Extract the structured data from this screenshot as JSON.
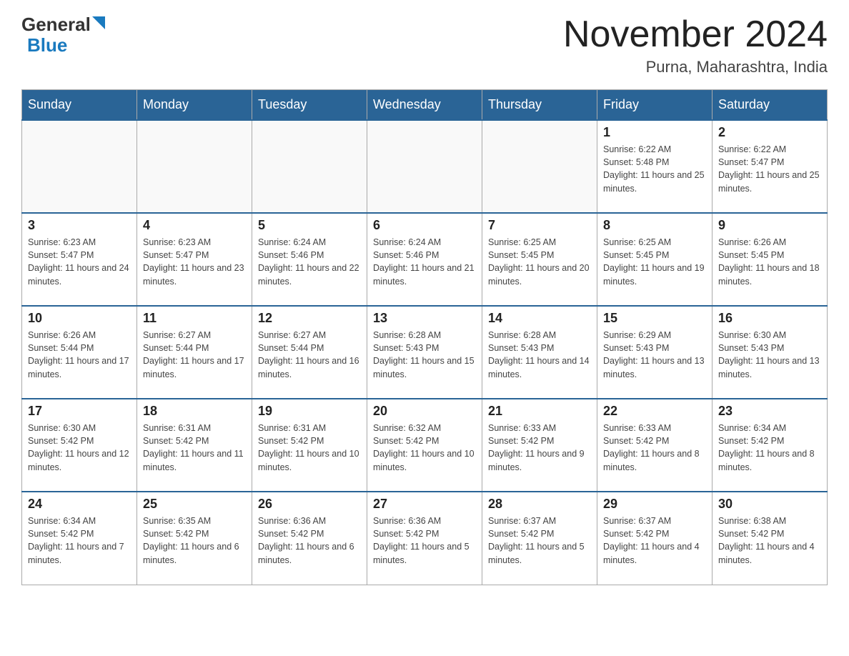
{
  "header": {
    "logo": {
      "general_text": "General",
      "blue_text": "Blue"
    },
    "title": "November 2024",
    "location": "Purna, Maharashtra, India"
  },
  "calendar": {
    "weekdays": [
      "Sunday",
      "Monday",
      "Tuesday",
      "Wednesday",
      "Thursday",
      "Friday",
      "Saturday"
    ],
    "weeks": [
      [
        {
          "day": "",
          "info": ""
        },
        {
          "day": "",
          "info": ""
        },
        {
          "day": "",
          "info": ""
        },
        {
          "day": "",
          "info": ""
        },
        {
          "day": "",
          "info": ""
        },
        {
          "day": "1",
          "info": "Sunrise: 6:22 AM\nSunset: 5:48 PM\nDaylight: 11 hours and 25 minutes."
        },
        {
          "day": "2",
          "info": "Sunrise: 6:22 AM\nSunset: 5:47 PM\nDaylight: 11 hours and 25 minutes."
        }
      ],
      [
        {
          "day": "3",
          "info": "Sunrise: 6:23 AM\nSunset: 5:47 PM\nDaylight: 11 hours and 24 minutes."
        },
        {
          "day": "4",
          "info": "Sunrise: 6:23 AM\nSunset: 5:47 PM\nDaylight: 11 hours and 23 minutes."
        },
        {
          "day": "5",
          "info": "Sunrise: 6:24 AM\nSunset: 5:46 PM\nDaylight: 11 hours and 22 minutes."
        },
        {
          "day": "6",
          "info": "Sunrise: 6:24 AM\nSunset: 5:46 PM\nDaylight: 11 hours and 21 minutes."
        },
        {
          "day": "7",
          "info": "Sunrise: 6:25 AM\nSunset: 5:45 PM\nDaylight: 11 hours and 20 minutes."
        },
        {
          "day": "8",
          "info": "Sunrise: 6:25 AM\nSunset: 5:45 PM\nDaylight: 11 hours and 19 minutes."
        },
        {
          "day": "9",
          "info": "Sunrise: 6:26 AM\nSunset: 5:45 PM\nDaylight: 11 hours and 18 minutes."
        }
      ],
      [
        {
          "day": "10",
          "info": "Sunrise: 6:26 AM\nSunset: 5:44 PM\nDaylight: 11 hours and 17 minutes."
        },
        {
          "day": "11",
          "info": "Sunrise: 6:27 AM\nSunset: 5:44 PM\nDaylight: 11 hours and 17 minutes."
        },
        {
          "day": "12",
          "info": "Sunrise: 6:27 AM\nSunset: 5:44 PM\nDaylight: 11 hours and 16 minutes."
        },
        {
          "day": "13",
          "info": "Sunrise: 6:28 AM\nSunset: 5:43 PM\nDaylight: 11 hours and 15 minutes."
        },
        {
          "day": "14",
          "info": "Sunrise: 6:28 AM\nSunset: 5:43 PM\nDaylight: 11 hours and 14 minutes."
        },
        {
          "day": "15",
          "info": "Sunrise: 6:29 AM\nSunset: 5:43 PM\nDaylight: 11 hours and 13 minutes."
        },
        {
          "day": "16",
          "info": "Sunrise: 6:30 AM\nSunset: 5:43 PM\nDaylight: 11 hours and 13 minutes."
        }
      ],
      [
        {
          "day": "17",
          "info": "Sunrise: 6:30 AM\nSunset: 5:42 PM\nDaylight: 11 hours and 12 minutes."
        },
        {
          "day": "18",
          "info": "Sunrise: 6:31 AM\nSunset: 5:42 PM\nDaylight: 11 hours and 11 minutes."
        },
        {
          "day": "19",
          "info": "Sunrise: 6:31 AM\nSunset: 5:42 PM\nDaylight: 11 hours and 10 minutes."
        },
        {
          "day": "20",
          "info": "Sunrise: 6:32 AM\nSunset: 5:42 PM\nDaylight: 11 hours and 10 minutes."
        },
        {
          "day": "21",
          "info": "Sunrise: 6:33 AM\nSunset: 5:42 PM\nDaylight: 11 hours and 9 minutes."
        },
        {
          "day": "22",
          "info": "Sunrise: 6:33 AM\nSunset: 5:42 PM\nDaylight: 11 hours and 8 minutes."
        },
        {
          "day": "23",
          "info": "Sunrise: 6:34 AM\nSunset: 5:42 PM\nDaylight: 11 hours and 8 minutes."
        }
      ],
      [
        {
          "day": "24",
          "info": "Sunrise: 6:34 AM\nSunset: 5:42 PM\nDaylight: 11 hours and 7 minutes."
        },
        {
          "day": "25",
          "info": "Sunrise: 6:35 AM\nSunset: 5:42 PM\nDaylight: 11 hours and 6 minutes."
        },
        {
          "day": "26",
          "info": "Sunrise: 6:36 AM\nSunset: 5:42 PM\nDaylight: 11 hours and 6 minutes."
        },
        {
          "day": "27",
          "info": "Sunrise: 6:36 AM\nSunset: 5:42 PM\nDaylight: 11 hours and 5 minutes."
        },
        {
          "day": "28",
          "info": "Sunrise: 6:37 AM\nSunset: 5:42 PM\nDaylight: 11 hours and 5 minutes."
        },
        {
          "day": "29",
          "info": "Sunrise: 6:37 AM\nSunset: 5:42 PM\nDaylight: 11 hours and 4 minutes."
        },
        {
          "day": "30",
          "info": "Sunrise: 6:38 AM\nSunset: 5:42 PM\nDaylight: 11 hours and 4 minutes."
        }
      ]
    ]
  }
}
